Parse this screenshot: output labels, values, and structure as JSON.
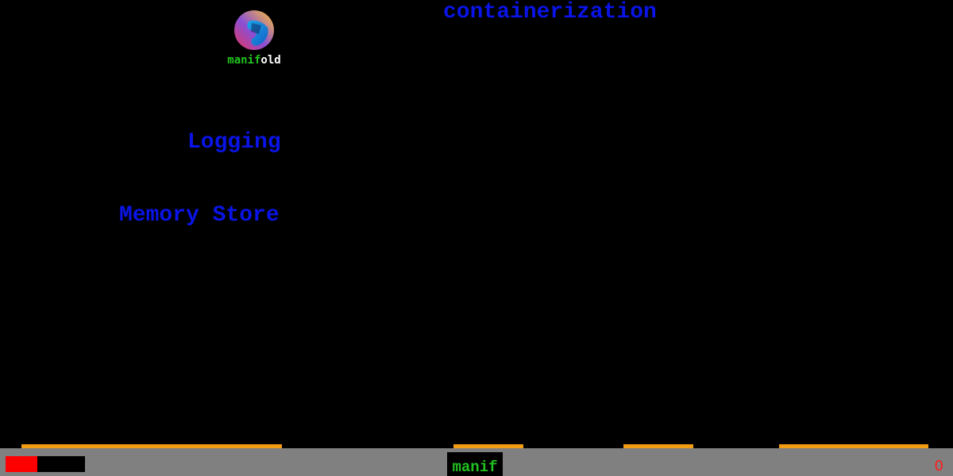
{
  "logo": {
    "icon": "manifold-logo-icon",
    "text_part_a": "manif",
    "text_part_b": "old"
  },
  "falling_words": [
    "containerization",
    "Logging",
    "Memory Store"
  ],
  "hud": {
    "health_fraction": 0.4,
    "input_text": "manif",
    "score": "0"
  },
  "colors": {
    "background": "#000000",
    "word": "#0a14e6",
    "typed": "#22c21f",
    "platform": "#f39c12",
    "hud": "#808080",
    "health": "#ff0000",
    "score": "#ff1a1a"
  }
}
